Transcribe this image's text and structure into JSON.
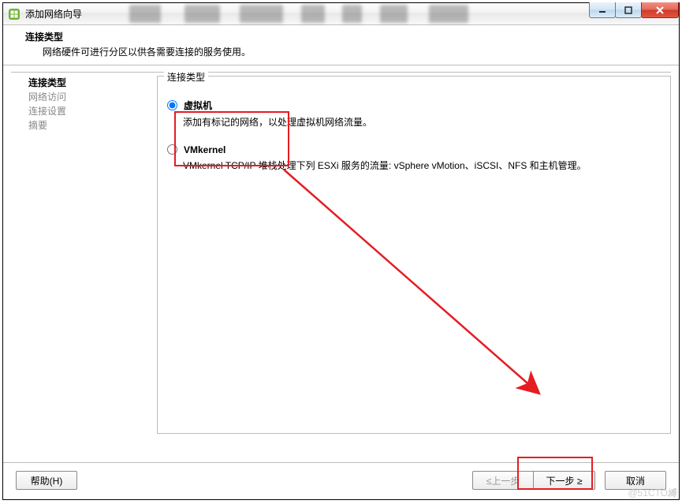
{
  "window": {
    "title": "添加网络向导"
  },
  "header": {
    "title": "连接类型",
    "subtitle": "网络硬件可进行分区以供各需要连接的服务使用。"
  },
  "sidebar": {
    "steps": [
      {
        "label": "连接类型",
        "active": true
      },
      {
        "label": "网络访问",
        "active": false
      },
      {
        "label": "连接设置",
        "active": false
      },
      {
        "label": "摘要",
        "active": false
      }
    ]
  },
  "group": {
    "legend": "连接类型",
    "options": [
      {
        "name": "vm",
        "title": "虚拟机",
        "desc": "添加有标记的网络，以处理虚拟机网络流量。",
        "selected": true
      },
      {
        "name": "vmkernel",
        "title": "VMkernel",
        "desc": "VMkernel TCP/IP 堆栈处理下列 ESXi 服务的流量: vSphere vMotion、iSCSI、NFS 和主机管理。",
        "selected": false
      }
    ]
  },
  "buttons": {
    "help": "帮助(H)",
    "back": "≤上一步",
    "next": "下一步 ≥",
    "cancel": "取消"
  },
  "watermark": "@51CTO博",
  "colors": {
    "highlight": "#e51c23"
  }
}
